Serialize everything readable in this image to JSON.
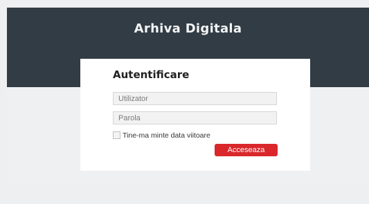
{
  "header": {
    "title": "Arhiva Digitala"
  },
  "login": {
    "title": "Autentificare",
    "username_placeholder": "Utilizator",
    "password_placeholder": "Parola",
    "remember_label": "Tine-ma minte data viitoare",
    "submit_label": "Acceseaza"
  },
  "colors": {
    "header_bg": "#323c44",
    "page_bg": "#eeeff0",
    "accent": "#d9272b"
  }
}
